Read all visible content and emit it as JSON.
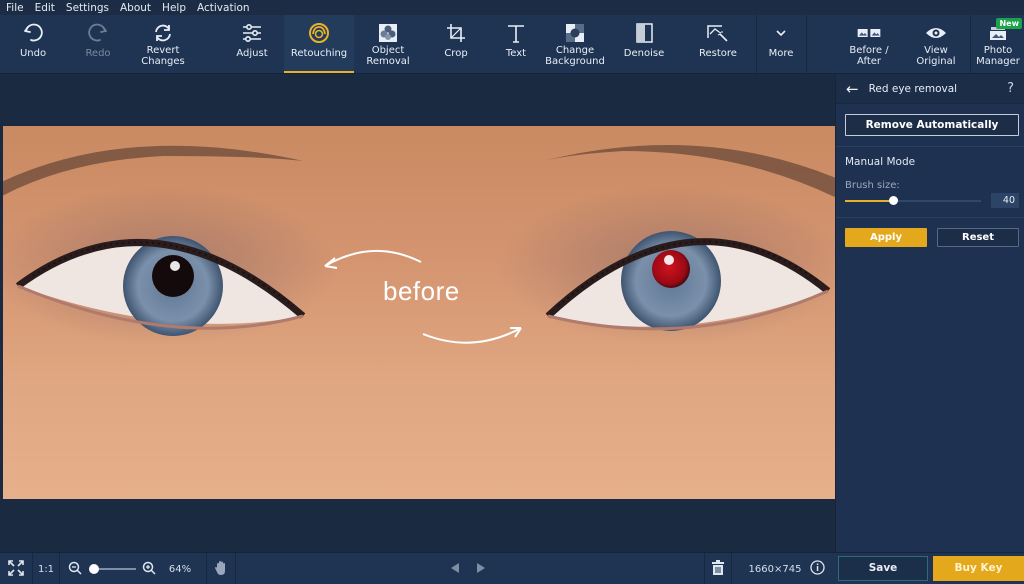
{
  "menu": [
    "File",
    "Edit",
    "Settings",
    "About",
    "Help",
    "Activation"
  ],
  "toolbar": {
    "undo": "Undo",
    "redo": "Redo",
    "revert": "Revert\nChanges",
    "adjust": "Adjust",
    "retouching": "Retouching",
    "object_removal": "Object\nRemoval",
    "crop": "Crop",
    "text": "Text",
    "change_background": "Change\nBackground",
    "denoise": "Denoise",
    "restore": "Restore",
    "more": "More",
    "before_after": "Before /\nAfter",
    "view_original": "View\nOriginal",
    "photo_manager": "Photo\nManager",
    "new_badge": "New",
    "active_tool": "Retouching"
  },
  "canvas": {
    "overlay_text": "before"
  },
  "panel": {
    "title": "Red eye removal",
    "help": "?",
    "remove_auto": "Remove Automatically",
    "manual_mode": "Manual Mode",
    "brush_size_label": "Brush size:",
    "brush_size_value": "40",
    "brush_size_fraction": 0.35,
    "apply": "Apply",
    "reset": "Reset"
  },
  "statusbar": {
    "one_to_one": "1:1",
    "zoom_percent": "64%",
    "dimensions": "1660×745",
    "save": "Save",
    "buy_key": "Buy Key"
  },
  "colors": {
    "accent": "#e3a81c",
    "toolbar_bg": "#1f3452",
    "canvas_bg": "#1a2a40",
    "new_badge": "#1aa34a"
  }
}
